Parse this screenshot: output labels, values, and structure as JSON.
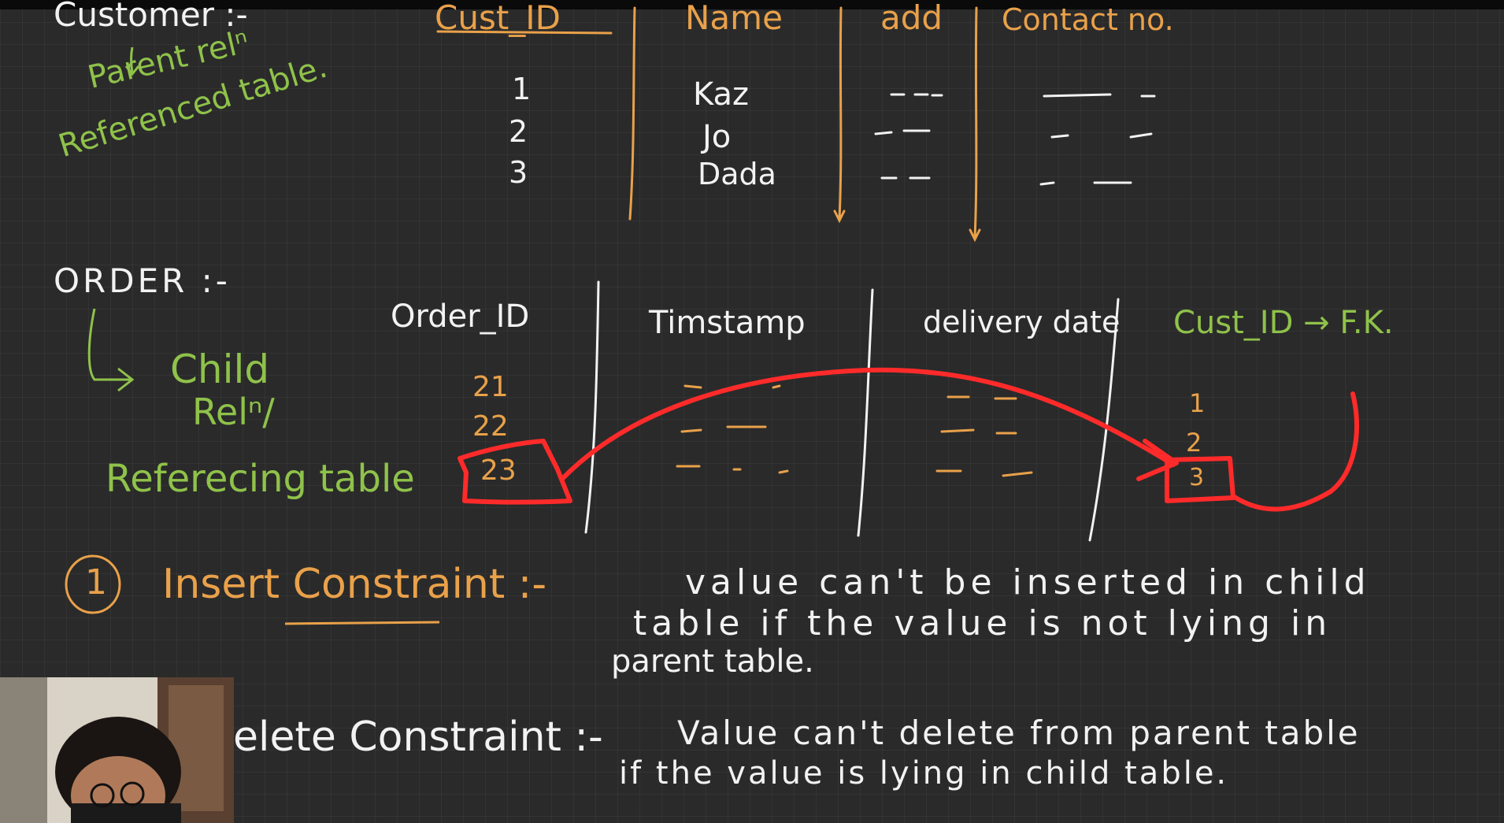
{
  "customer": {
    "title": "Customer :-",
    "note_parent": "Parent relⁿ",
    "note_referenced": "Referenced table.",
    "headers": [
      "Cust_ID",
      "Name",
      "add",
      "Contact no."
    ],
    "rows": [
      {
        "cust_id": "1",
        "name": "Kaz"
      },
      {
        "cust_id": "2",
        "name": "Jo"
      },
      {
        "cust_id": "3",
        "name": "Dada"
      }
    ]
  },
  "order": {
    "title": "ORDER :-",
    "note_child": "Child",
    "note_rel": "Relⁿ/",
    "note_referencing": "Referecing table",
    "headers": [
      "Order_ID",
      "Timstamp",
      "delivery date",
      "Cust_ID → F.K."
    ],
    "order_ids": [
      "21",
      "22",
      "23"
    ],
    "cust_ids": [
      "1",
      "2",
      "3"
    ]
  },
  "constraints": {
    "insert_number": "1",
    "insert_title": "Insert Constraint :-",
    "insert_desc": [
      "value can't be inserted in child",
      "table if the value is not lying in",
      "parent table."
    ],
    "delete_title": "elete Constraint :-",
    "delete_desc": [
      "Value can't delete from parent table",
      "if the value is lying in child table."
    ]
  },
  "colors": {
    "board": "#2a2a2a",
    "white_ink": "#f2f2f2",
    "orange_ink": "#e9a14a",
    "green_ink": "#8fc24a",
    "red_highlight": "#ff2a2a"
  }
}
